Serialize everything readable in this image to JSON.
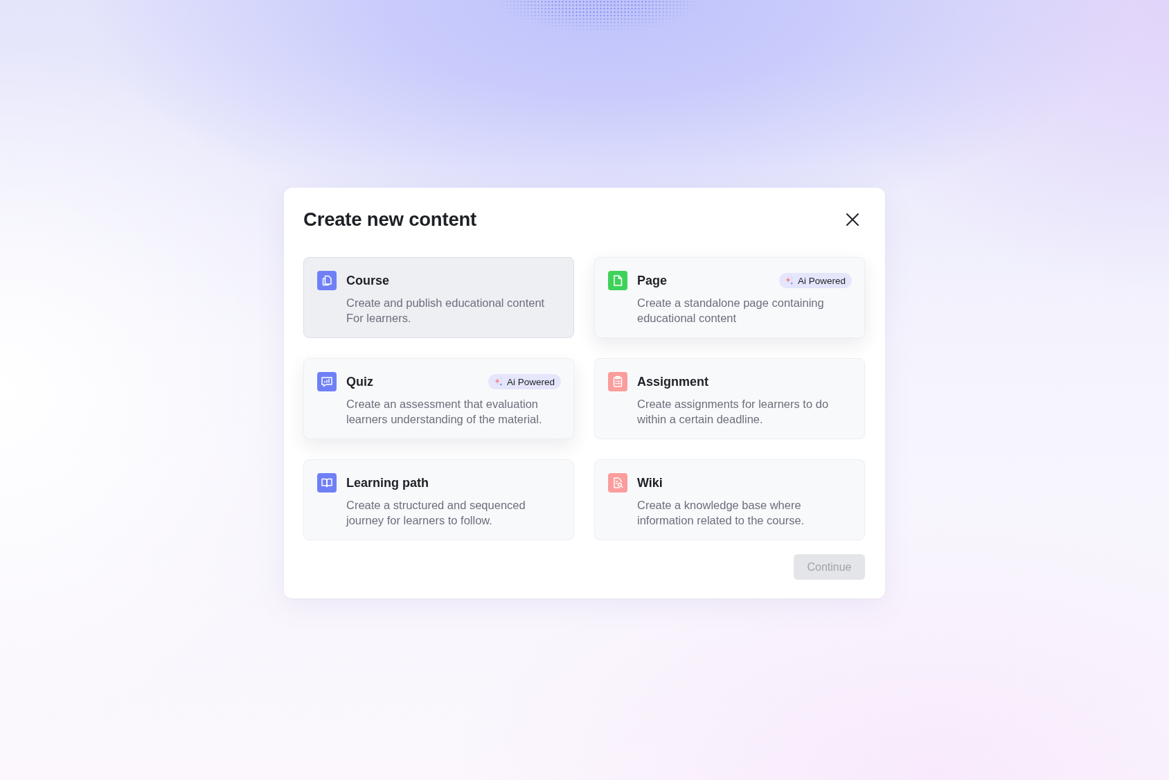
{
  "dialog": {
    "title": "Create new content",
    "cards": [
      {
        "title": "Course",
        "description": [
          "Create and publish educational content",
          "For learners."
        ],
        "color": "#6f80f6",
        "selected": true,
        "raised": false
      },
      {
        "title": "Page",
        "badge": "Ai Powered",
        "description": [
          "Create a standalone page containing",
          "educational content"
        ],
        "color": "#3fd25a",
        "selected": false,
        "raised": true
      },
      {
        "title": "Quiz",
        "badge": "Ai Powered",
        "description": [
          "Create an assessment that evaluation",
          "learners understanding of the material."
        ],
        "color": "#6f80f6",
        "selected": false,
        "raised": true
      },
      {
        "title": "Assignment",
        "description": [
          "Create assignments for learners to do",
          "within a certain deadline."
        ],
        "color": "#fa9d9c",
        "selected": false,
        "raised": false
      },
      {
        "title": "Learning path",
        "description": [
          "Create a structured and sequenced",
          "journey for learners to follow."
        ],
        "color": "#6f80f6",
        "selected": false,
        "raised": false
      },
      {
        "title": "Wiki",
        "description": [
          "Create a knowledge base where",
          "information related to the course."
        ],
        "color": "#fa9d9c",
        "selected": false,
        "raised": false
      }
    ],
    "continue_button": {
      "label": "Continue",
      "disabled": true
    }
  }
}
